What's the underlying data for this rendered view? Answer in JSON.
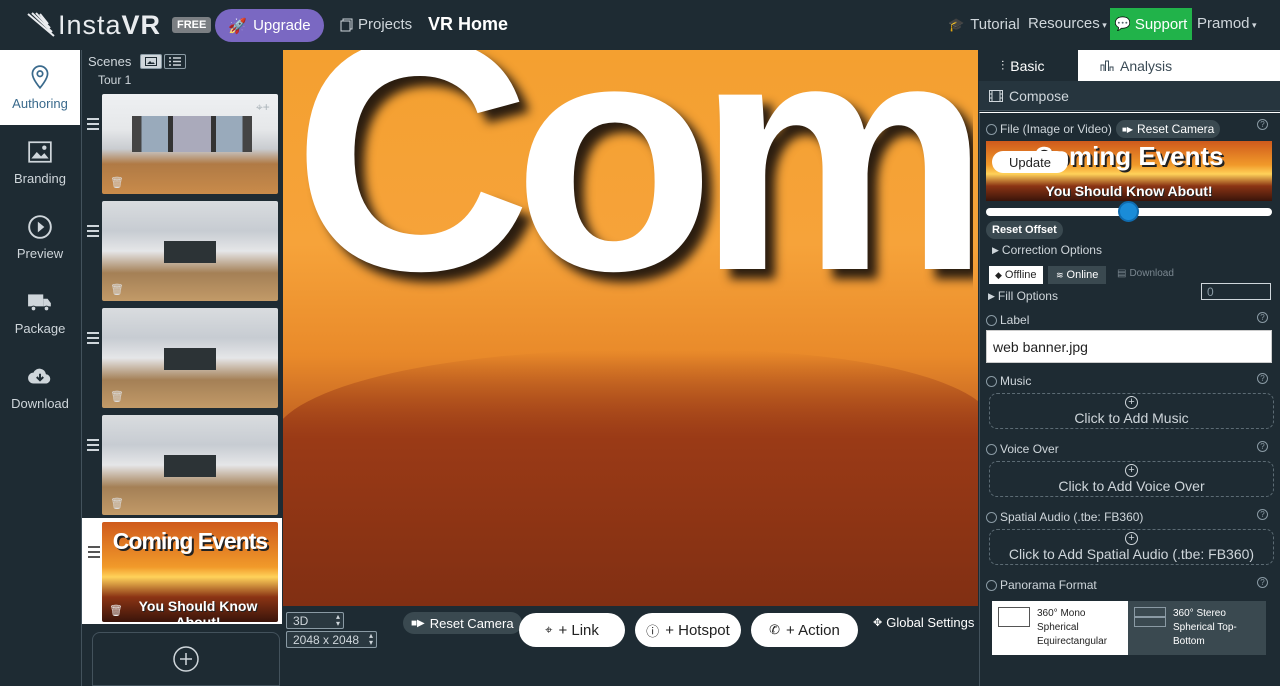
{
  "header": {
    "logo_a": "Insta",
    "logo_b": "VR",
    "plan_badge": "FREE",
    "upgrade": "Upgrade",
    "projects": "Projects",
    "page_title": "VR Home",
    "tutorial": "Tutorial",
    "resources": "Resources",
    "support": "Support",
    "user": "Pramod"
  },
  "leftnav": [
    {
      "label": "Authoring",
      "icon": "location-pin-icon",
      "active": true
    },
    {
      "label": "Branding",
      "icon": "image-icon"
    },
    {
      "label": "Preview",
      "icon": "play-icon"
    },
    {
      "label": "Package",
      "icon": "truck-icon"
    },
    {
      "label": "Download",
      "icon": "cloud-download-icon"
    }
  ],
  "scenes": {
    "heading": "Scenes",
    "tour": "Tour 1",
    "selected_title": "Coming Events",
    "selected_subtitle": "You Should Know About!"
  },
  "viewer": {
    "mode": "3D",
    "resolution": "2048 x 2048",
    "reset_camera": "Reset Camera",
    "link": "+ Link",
    "hotspot": "+ Hotspot",
    "action": "+ Action",
    "global_settings": "Global Settings"
  },
  "panel": {
    "tab_basic": "Basic",
    "tab_analysis": "Analysis",
    "compose": "Compose",
    "file_label": "File (Image or Video)",
    "reset_camera": "Reset Camera",
    "update": "Update",
    "thumb_title": "Coming Events",
    "thumb_subtitle": "You Should Know About!",
    "slider_value": 0.5,
    "reset_offset": "Reset Offset",
    "offset_value": "0",
    "correction": "Correction Options",
    "offline": "Offline",
    "online": "Online",
    "download": "Download",
    "fill": "Fill Options",
    "label_title": "Label",
    "label_value": "web banner.jpg",
    "music_title": "Music",
    "music_add": "Click to Add Music",
    "voice_title": "Voice Over",
    "voice_add": "Click to Add Voice Over",
    "spatial_title": "Spatial Audio (.tbe: FB360)",
    "spatial_add": "Click to Add Spatial Audio (.tbe: FB360)",
    "pano_title": "Panorama Format",
    "pano_opt1": "360° Mono Spherical Equirectangular",
    "pano_opt2": "360° Stereo Spherical Top-Bottom"
  },
  "colors": {
    "accent": "#7a68c2",
    "support": "#21b34a",
    "bg": "#1e2b33",
    "slider": "#1a8cd8"
  }
}
